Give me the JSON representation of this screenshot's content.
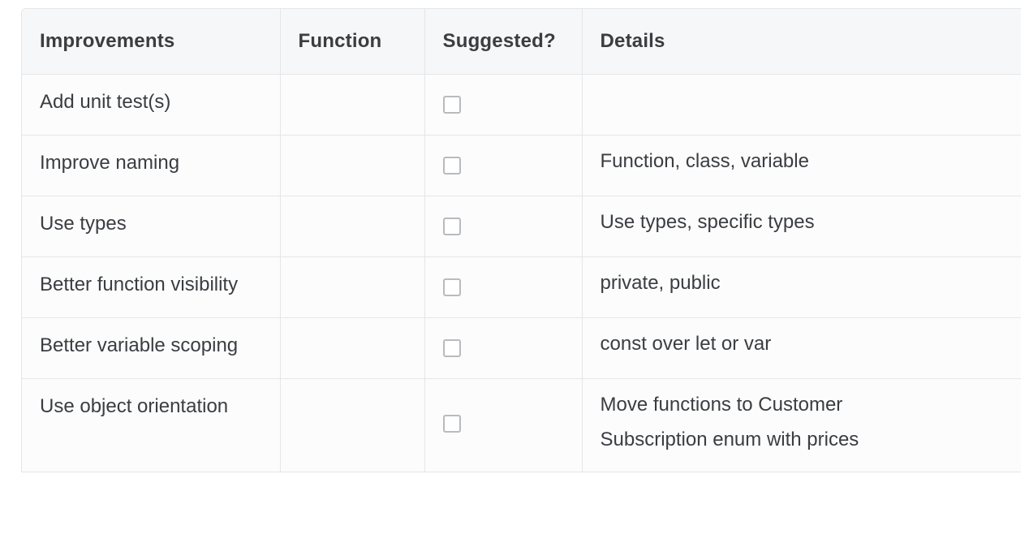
{
  "table": {
    "headers": [
      "Improvements",
      "Function",
      "Suggested?",
      "Details"
    ],
    "rows": [
      {
        "improvement": "Add unit test(s)",
        "function": "",
        "suggested": false,
        "details": [
          ""
        ]
      },
      {
        "improvement": "Improve naming",
        "function": "",
        "suggested": false,
        "details": [
          "Function, class, variable"
        ]
      },
      {
        "improvement": "Use types",
        "function": "",
        "suggested": false,
        "details": [
          "Use types, specific types"
        ]
      },
      {
        "improvement": "Better function visibility",
        "function": "",
        "suggested": false,
        "details": [
          "private, public"
        ]
      },
      {
        "improvement": "Better variable scoping",
        "function": "",
        "suggested": false,
        "details": [
          "const over let or var"
        ]
      },
      {
        "improvement": "Use object orientation",
        "function": "",
        "suggested": false,
        "details": [
          "Move functions to Customer",
          "Subscription enum with prices"
        ]
      }
    ]
  }
}
